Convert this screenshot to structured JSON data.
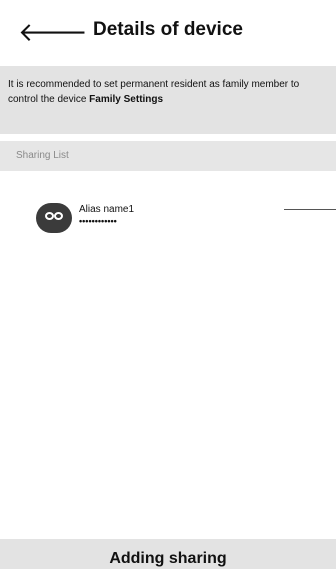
{
  "header": {
    "back_icon": "arrow-left-icon",
    "back_glyph": "🡐",
    "title": "Details of device"
  },
  "notice": {
    "text": "It is recommended to set permanent resident as family member to control the device ",
    "link": "Family Settings"
  },
  "sharing_list": {
    "label": "Sharing List",
    "items": [
      {
        "name": "Alias name1",
        "account": "••••••••••••",
        "avatar_icon": "user-avatar-icon"
      }
    ]
  },
  "footer": {
    "button_label": "Adding sharing"
  }
}
